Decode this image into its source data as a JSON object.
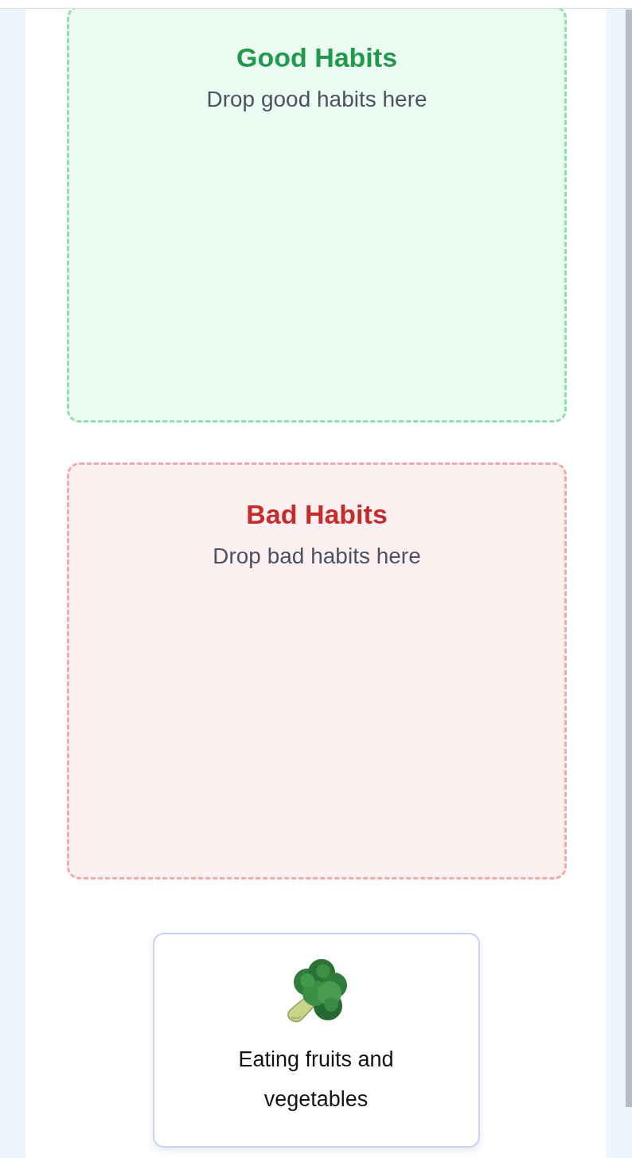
{
  "drop_zones": [
    {
      "kind": "good",
      "title": "Good Habits",
      "subtitle": "Drop good habits here"
    },
    {
      "kind": "bad",
      "title": "Bad Habits",
      "subtitle": "Drop bad habits here"
    }
  ],
  "habit_cards": [
    {
      "label": "Eating fruits and vegetables"
    }
  ]
}
